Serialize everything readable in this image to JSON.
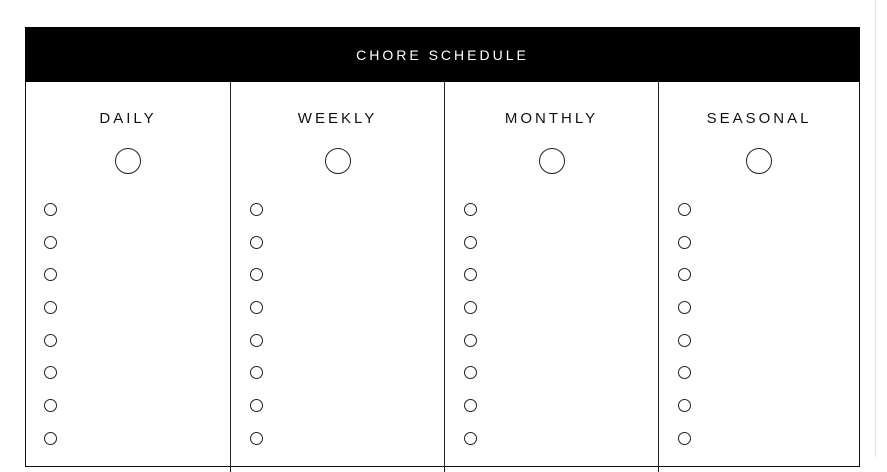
{
  "title": "CHORE SCHEDULE",
  "columns": [
    {
      "heading": "DAILY",
      "checkbox_count": 8
    },
    {
      "heading": "WEEKLY",
      "checkbox_count": 8
    },
    {
      "heading": "MONTHLY",
      "checkbox_count": 8
    },
    {
      "heading": "SEASONAL",
      "checkbox_count": 8
    }
  ],
  "colors": {
    "header_background": "#000000",
    "header_text": "#ffffff",
    "lines": "#222222"
  }
}
